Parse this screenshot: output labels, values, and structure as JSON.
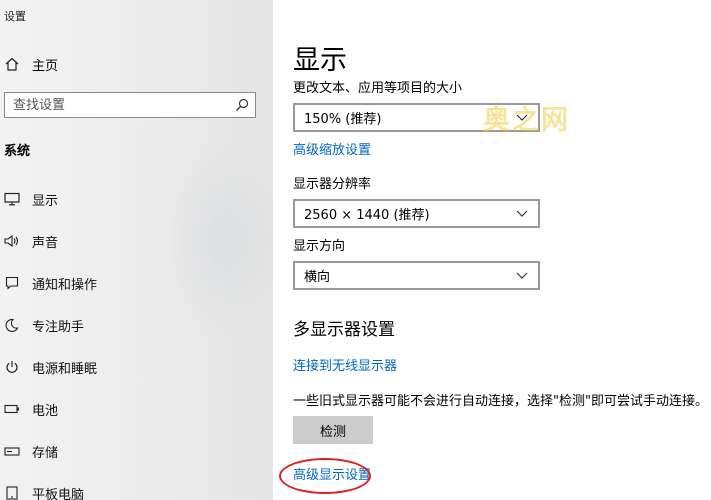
{
  "window": {
    "title": "设置"
  },
  "sidebar": {
    "home_label": "主页",
    "search_placeholder": "查找设置",
    "section_title": "系统",
    "items": [
      {
        "label": "显示",
        "icon": "monitor-icon"
      },
      {
        "label": "声音",
        "icon": "speaker-icon"
      },
      {
        "label": "通知和操作",
        "icon": "notification-icon"
      },
      {
        "label": "专注助手",
        "icon": "moon-icon"
      },
      {
        "label": "电源和睡眠",
        "icon": "power-icon"
      },
      {
        "label": "电池",
        "icon": "battery-icon"
      },
      {
        "label": "存储",
        "icon": "storage-icon"
      },
      {
        "label": "平板电脑",
        "icon": "tablet-icon"
      }
    ]
  },
  "main": {
    "title": "显示",
    "scale_label": "更改文本、应用等项目的大小",
    "scale_value": "150% (推荐)",
    "advanced_scaling_link": "高级缩放设置",
    "resolution_label": "显示器分辨率",
    "resolution_value": "2560 × 1440 (推荐)",
    "orientation_label": "显示方向",
    "orientation_value": "横向",
    "multi_display_heading": "多显示器设置",
    "wireless_link": "连接到无线显示器",
    "hint_text": "一些旧式显示器可能不会进行自动连接，选择\"检测\"即可尝试手动连接。",
    "detect_button": "检测",
    "advanced_display_link": "高级显示设置"
  },
  "watermark": "奥之网",
  "colors": {
    "link": "#0067c0",
    "highlight_circle": "#e02020",
    "button_bg": "#cccccc"
  }
}
